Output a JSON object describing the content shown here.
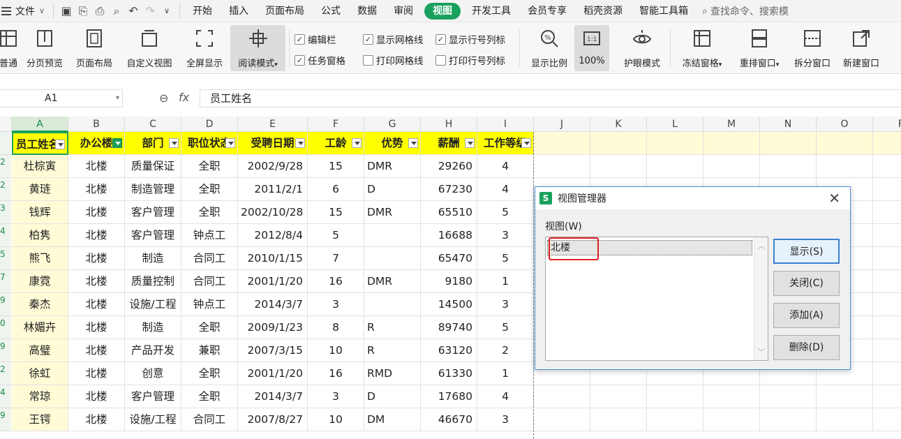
{
  "menubar": {
    "file_label": "文件",
    "tabs": [
      "开始",
      "插入",
      "页面布局",
      "公式",
      "数据",
      "审阅",
      "视图",
      "开发工具",
      "会员专享",
      "稻壳资源",
      "智能工具箱"
    ],
    "active_tab": "视图",
    "search_placeholder": "查找命令、搜索模"
  },
  "ribbon": {
    "buttons": [
      "普通",
      "分页预览",
      "页面布局",
      "自定义视图",
      "全屏显示",
      "阅读模式",
      "显示比例",
      "100%",
      "护眼模式",
      "冻结窗格",
      "重排窗口",
      "拆分窗口",
      "新建窗口"
    ],
    "checks": [
      {
        "label": "编辑栏",
        "checked": true
      },
      {
        "label": "任务窗格",
        "checked": true
      },
      {
        "label": "显示网格线",
        "checked": true
      },
      {
        "label": "打印网格线",
        "checked": false
      },
      {
        "label": "显示行号列标",
        "checked": true
      },
      {
        "label": "打印行号列标",
        "checked": false
      }
    ]
  },
  "formula_bar": {
    "name_box": "A1",
    "fx": "fx",
    "content": "员工姓名"
  },
  "columns": [
    "A",
    "B",
    "C",
    "D",
    "E",
    "F",
    "G",
    "H",
    "I",
    "J",
    "K",
    "L",
    "M",
    "N",
    "O",
    "P"
  ],
  "headers": [
    "员工姓名",
    "办公楼",
    "部门",
    "职位状态",
    "受聘日期",
    "工龄",
    "优势",
    "薪酬",
    "工作等级"
  ],
  "row_numbers": [
    "2",
    "2",
    "3",
    "4",
    "5",
    "7",
    "9",
    "0",
    "9",
    "2",
    "4",
    "9"
  ],
  "rows": [
    [
      "杜棕寅",
      "北楼",
      "质量保证",
      "全职",
      "2002/9/28",
      "15",
      "DMR",
      "29260",
      "4"
    ],
    [
      "黄琏",
      "北楼",
      "制造管理",
      "全职",
      "2011/2/1",
      "6",
      "D",
      "67230",
      "4"
    ],
    [
      "钱辉",
      "北楼",
      "客户管理",
      "全职",
      "2002/10/28",
      "15",
      "DMR",
      "65510",
      "5"
    ],
    [
      "柏隽",
      "北楼",
      "客户管理",
      "钟点工",
      "2012/8/4",
      "5",
      "",
      "16688",
      "3"
    ],
    [
      "熊飞",
      "北楼",
      "制造",
      "合同工",
      "2010/1/15",
      "7",
      "",
      "65470",
      "5"
    ],
    [
      "康霓",
      "北楼",
      "质量控制",
      "合同工",
      "2001/1/20",
      "16",
      "DMR",
      "9180",
      "1"
    ],
    [
      "秦杰",
      "北楼",
      "设施/工程",
      "钟点工",
      "2014/3/7",
      "3",
      "",
      "14500",
      "3"
    ],
    [
      "林媚卉",
      "北楼",
      "制造",
      "全职",
      "2009/1/23",
      "8",
      "R",
      "89740",
      "5"
    ],
    [
      "高璧",
      "北楼",
      "产品开发",
      "兼职",
      "2007/3/15",
      "10",
      "R",
      "63120",
      "2"
    ],
    [
      "徐虹",
      "北楼",
      "创意",
      "全职",
      "2001/1/20",
      "16",
      "RMD",
      "61330",
      "1"
    ],
    [
      "常琼",
      "北楼",
      "客户管理",
      "全职",
      "2014/3/7",
      "3",
      "D",
      "17680",
      "4"
    ],
    [
      "王锷",
      "北楼",
      "设施/工程",
      "合同工",
      "2007/8/27",
      "10",
      "DM",
      "46670",
      "3"
    ]
  ],
  "dialog": {
    "title": "视图管理器",
    "logo": "S",
    "list_label": "视图(W)",
    "items": [
      "北楼"
    ],
    "buttons": [
      "显示(S)",
      "关闭(C)",
      "添加(A)",
      "删除(D)"
    ]
  }
}
